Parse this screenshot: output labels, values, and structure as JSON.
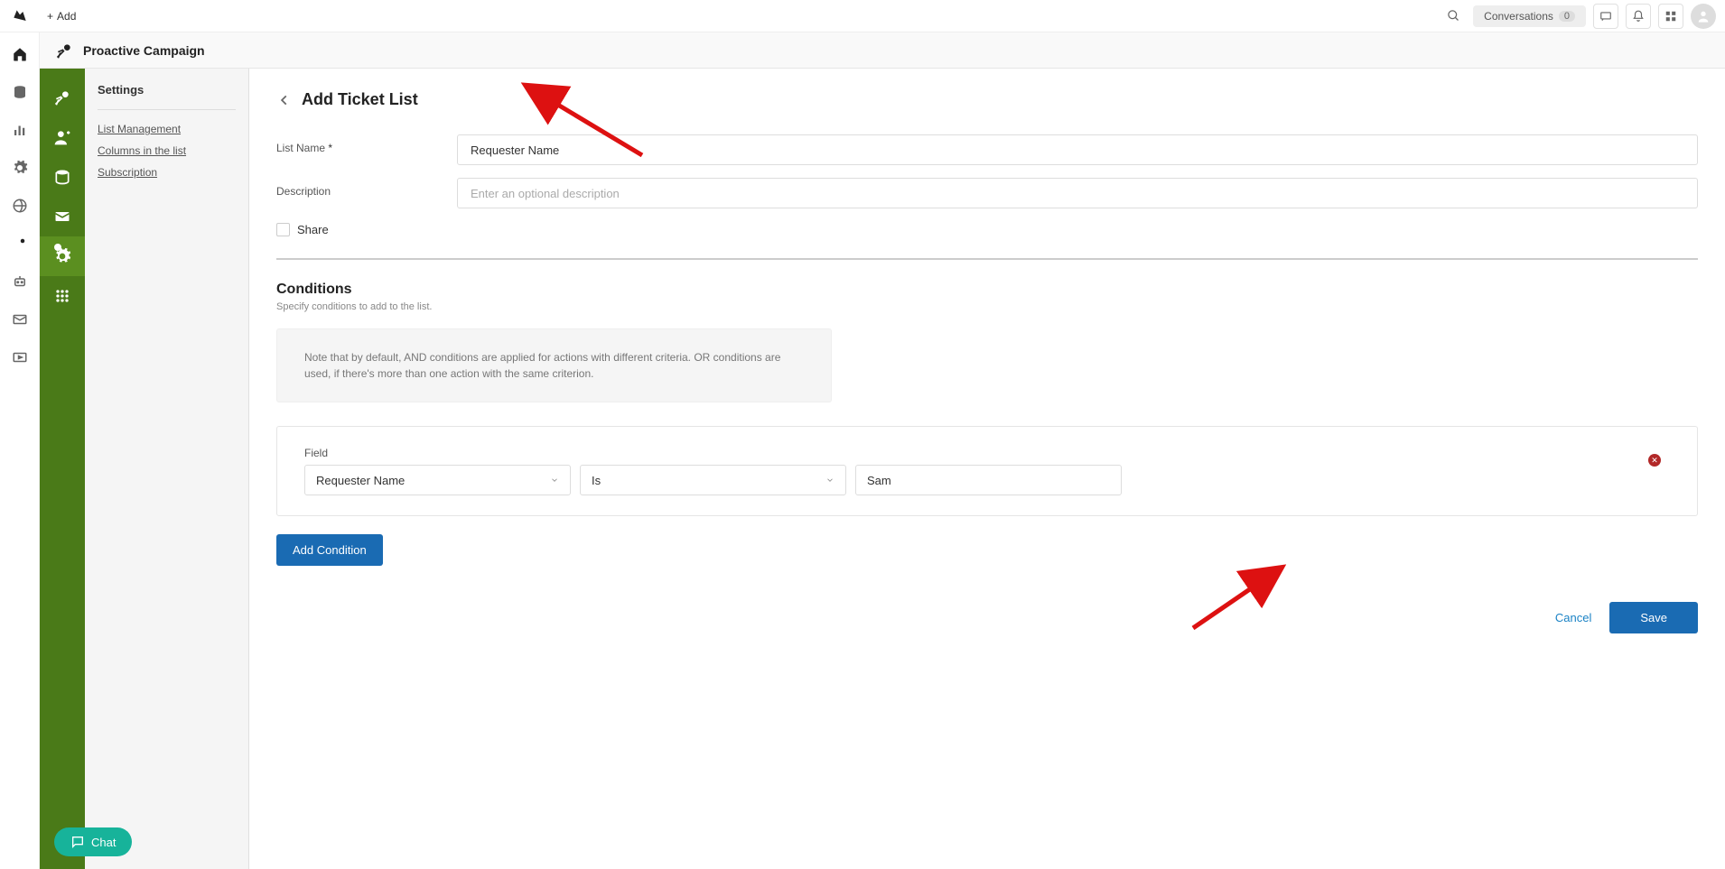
{
  "topbar": {
    "add_label": "Add",
    "conversations_label": "Conversations",
    "conversations_count": "0"
  },
  "strip": {
    "title": "Proactive Campaign"
  },
  "side": {
    "title": "Settings",
    "links": [
      "List Management",
      "Columns in the list",
      "Subscription"
    ]
  },
  "page": {
    "title": "Add Ticket List",
    "list_name_label": "List Name",
    "required": "*",
    "list_name_value": "Requester Name",
    "description_label": "Description",
    "description_placeholder": "Enter an optional description",
    "share_label": "Share"
  },
  "conditions": {
    "heading": "Conditions",
    "sub": "Specify conditions to add to the list.",
    "info": "Note that by default, AND conditions are applied for actions with different criteria. OR conditions are used, if there's more than one action with the same criterion.",
    "field_label": "Field",
    "field_value": "Requester Name",
    "operator_value": "Is",
    "value_value": "Sam",
    "add_btn": "Add Condition"
  },
  "footer": {
    "cancel": "Cancel",
    "save": "Save"
  },
  "chat": {
    "label": "Chat"
  }
}
